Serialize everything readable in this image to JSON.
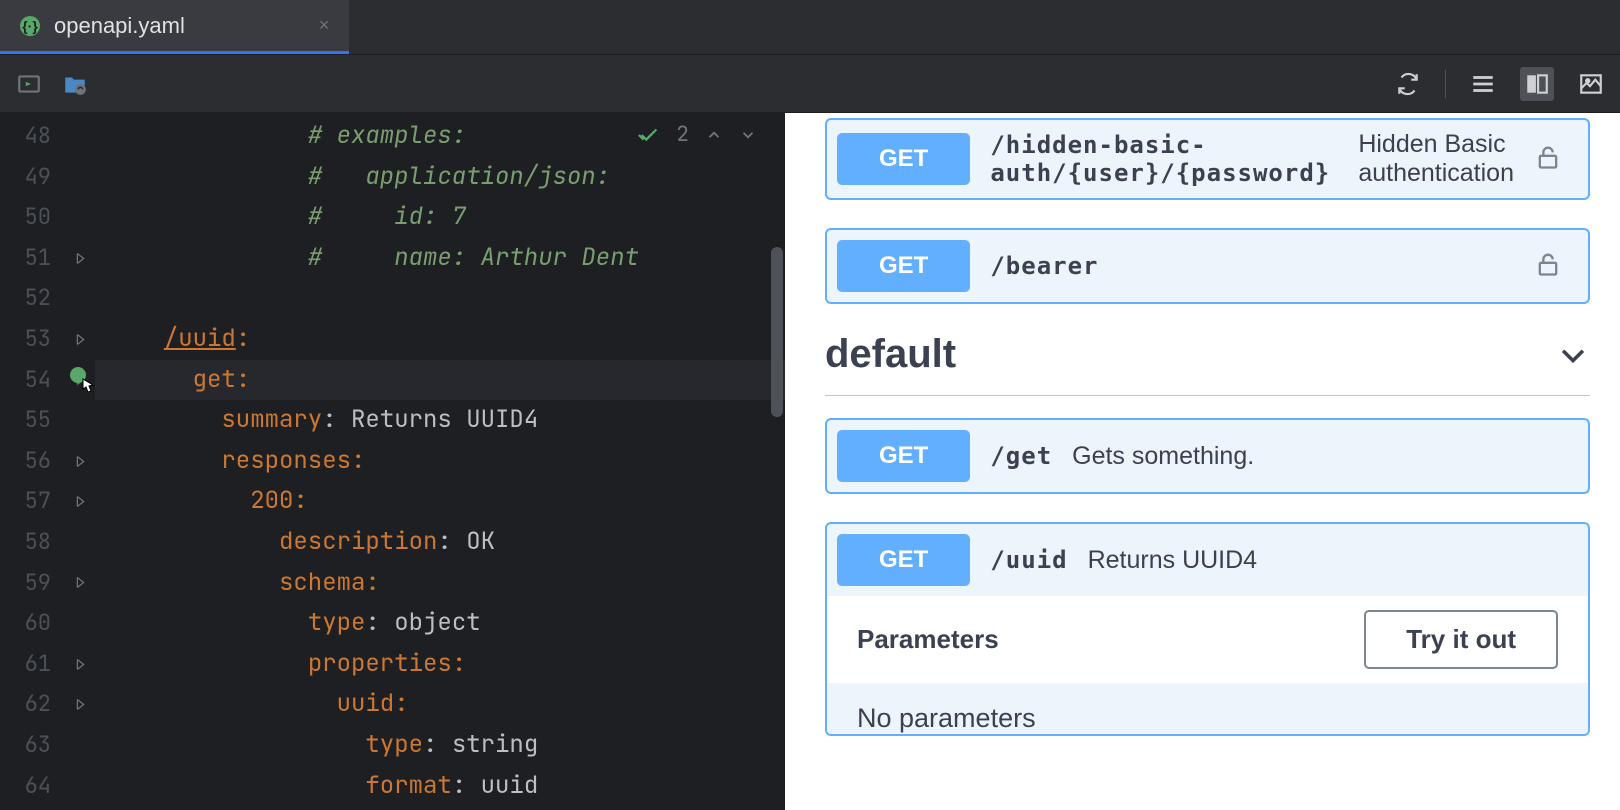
{
  "tab": {
    "filename": "openapi.yaml",
    "icon": "{·}"
  },
  "inspection": {
    "count": "2"
  },
  "gutter": {
    "start": 48,
    "end": 64
  },
  "code": [
    {
      "n": 48,
      "indent": 12,
      "tokens": [
        {
          "t": "# examples:",
          "c": "c-comment"
        }
      ]
    },
    {
      "n": 49,
      "indent": 12,
      "tokens": [
        {
          "t": "#   application/json:",
          "c": "c-comment"
        }
      ]
    },
    {
      "n": 50,
      "indent": 12,
      "tokens": [
        {
          "t": "#     id: 7",
          "c": "c-comment"
        }
      ]
    },
    {
      "n": 51,
      "indent": 12,
      "tokens": [
        {
          "t": "#     name: Arthur Dent",
          "c": "c-comment"
        }
      ],
      "fold": true
    },
    {
      "n": 52,
      "indent": 0,
      "tokens": []
    },
    {
      "n": 53,
      "indent": 2,
      "tokens": [
        {
          "t": "/uuid",
          "c": "c-key c-underline"
        },
        {
          "t": ":",
          "c": "c-key"
        }
      ],
      "fold": true
    },
    {
      "n": 54,
      "indent": 4,
      "tokens": [
        {
          "t": "get",
          "c": "c-key"
        },
        {
          "t": ":",
          "c": "c-key"
        }
      ],
      "fold": true,
      "highlight": true
    },
    {
      "n": 55,
      "indent": 6,
      "tokens": [
        {
          "t": "summary",
          "c": "c-key"
        },
        {
          "t": ": ",
          "c": ""
        },
        {
          "t": "Returns UUID4",
          "c": "c-string"
        }
      ]
    },
    {
      "n": 56,
      "indent": 6,
      "tokens": [
        {
          "t": "responses",
          "c": "c-key"
        },
        {
          "t": ":",
          "c": "c-key"
        }
      ],
      "fold": true
    },
    {
      "n": 57,
      "indent": 8,
      "tokens": [
        {
          "t": "200",
          "c": "c-key"
        },
        {
          "t": ":",
          "c": "c-key"
        }
      ],
      "fold": true
    },
    {
      "n": 58,
      "indent": 10,
      "tokens": [
        {
          "t": "description",
          "c": "c-key"
        },
        {
          "t": ": ",
          "c": ""
        },
        {
          "t": "OK",
          "c": "c-string"
        }
      ]
    },
    {
      "n": 59,
      "indent": 10,
      "tokens": [
        {
          "t": "schema",
          "c": "c-key"
        },
        {
          "t": ":",
          "c": "c-key"
        }
      ],
      "fold": true
    },
    {
      "n": 60,
      "indent": 12,
      "tokens": [
        {
          "t": "type",
          "c": "c-key"
        },
        {
          "t": ": ",
          "c": ""
        },
        {
          "t": "object",
          "c": "c-string"
        }
      ]
    },
    {
      "n": 61,
      "indent": 12,
      "tokens": [
        {
          "t": "properties",
          "c": "c-key"
        },
        {
          "t": ":",
          "c": "c-key"
        }
      ],
      "fold": true
    },
    {
      "n": 62,
      "indent": 14,
      "tokens": [
        {
          "t": "uuid",
          "c": "c-key"
        },
        {
          "t": ":",
          "c": "c-key"
        }
      ],
      "fold": true
    },
    {
      "n": 63,
      "indent": 16,
      "tokens": [
        {
          "t": "type",
          "c": "c-key"
        },
        {
          "t": ": ",
          "c": ""
        },
        {
          "t": "string",
          "c": "c-string"
        }
      ]
    },
    {
      "n": 64,
      "indent": 16,
      "tokens": [
        {
          "t": "format",
          "c": "c-key"
        },
        {
          "t": ": ",
          "c": ""
        },
        {
          "t": "uuid",
          "c": "c-string"
        }
      ]
    }
  ],
  "preview": {
    "endpoints_top": [
      {
        "method": "GET",
        "path": "/hidden-basic-auth/{user}/{password}",
        "desc": "Hidden Basic authentication",
        "lock": true
      },
      {
        "method": "GET",
        "path": "/bearer",
        "desc": "",
        "lock": true
      }
    ],
    "section": "default",
    "endpoints_bottom": [
      {
        "method": "GET",
        "path": "/get",
        "desc": "Gets something.",
        "lock": false
      },
      {
        "method": "GET",
        "path": "/uuid",
        "desc": "Returns UUID4",
        "lock": false,
        "expanded": true
      }
    ],
    "params_title": "Parameters",
    "try_btn": "Try it out",
    "no_params": "No parameters"
  }
}
